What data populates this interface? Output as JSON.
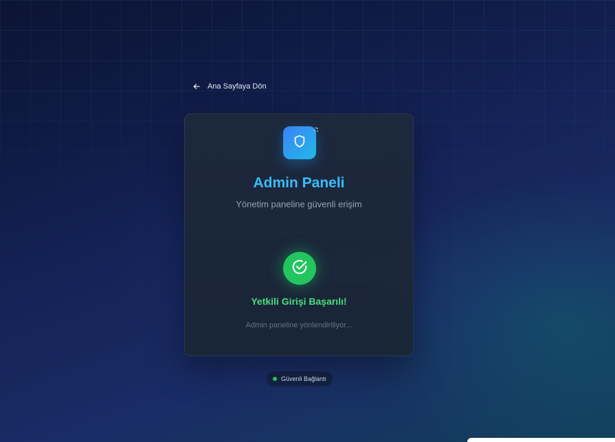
{
  "nav": {
    "back_label": "Ana Sayfaya Dön",
    "back_icon": "arrow-left-icon"
  },
  "card": {
    "logo_icon": "shield-icon",
    "title": "Admin Paneli",
    "subtitle": "Yönetim paneline güvenli erişim",
    "status": {
      "icon": "check-circle-icon",
      "title": "Yetkili Girişi Başarılı!",
      "message": "Admin paneline yönlendiriliyor..."
    }
  },
  "footer": {
    "badge_label": "Güvenli Bağlantı"
  },
  "colors": {
    "accent": "#38bdf8",
    "success": "#22c55e",
    "success_text": "#4ade80",
    "logo_gradient_start": "#3b82f6",
    "logo_gradient_end": "#22b8e8"
  }
}
